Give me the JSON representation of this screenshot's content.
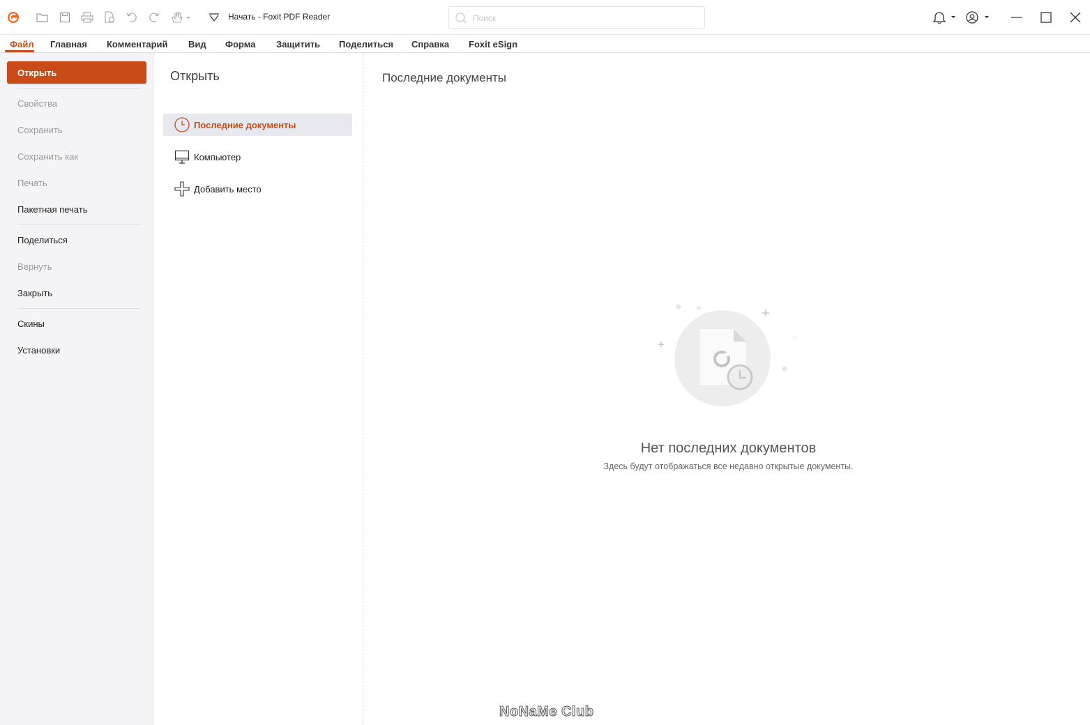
{
  "window": {
    "title": "Начать - Foxit PDF Reader",
    "brand_color": "#c94c18"
  },
  "toolbar": {
    "icons": [
      "foxit-logo-icon",
      "open-folder-icon",
      "save-icon",
      "print-icon",
      "create-pdf-icon",
      "undo-icon",
      "redo-icon",
      "hand-tool-icon",
      "customize-toolbar-icon"
    ]
  },
  "search": {
    "placeholder": "Поиск",
    "value": ""
  },
  "right_controls": [
    "bell-icon",
    "account-icon",
    "minimize-icon",
    "maximize-icon",
    "close-icon"
  ],
  "tabs": [
    {
      "label": "Файл",
      "active": true
    },
    {
      "label": "Главная"
    },
    {
      "label": "Комментарий"
    },
    {
      "label": "Вид"
    },
    {
      "label": "Форма"
    },
    {
      "label": "Защитить"
    },
    {
      "label": "Поделиться"
    },
    {
      "label": "Справка"
    },
    {
      "label": "Foxit eSign"
    }
  ],
  "sidebar": {
    "open_label": "Открыть",
    "items": [
      {
        "label": "Свойства",
        "enabled": false
      },
      {
        "label": "Сохранить",
        "enabled": false
      },
      {
        "label": "Сохранить как",
        "enabled": false
      },
      {
        "label": "Печать",
        "enabled": false
      },
      {
        "label": "Пакетная печать",
        "enabled": true
      },
      {
        "label": "Поделиться",
        "enabled": true
      },
      {
        "label": "Вернуть",
        "enabled": false
      },
      {
        "label": "Закрыть",
        "enabled": true
      },
      {
        "label": "Скины",
        "enabled": true
      },
      {
        "label": "Установки",
        "enabled": true
      }
    ]
  },
  "open_panel": {
    "title": "Открыть",
    "locations": [
      {
        "label": "Последние документы",
        "icon": "clock-icon",
        "selected": true
      },
      {
        "label": "Компьютер",
        "icon": "monitor-icon"
      },
      {
        "label": "Добавить место",
        "icon": "plus-icon"
      }
    ]
  },
  "main": {
    "title": "Последние документы",
    "empty_title": "Нет последних документов",
    "empty_subtitle": "Здесь будут отображаться все недавно открытые документы."
  },
  "watermark": "NoNaMe Club"
}
